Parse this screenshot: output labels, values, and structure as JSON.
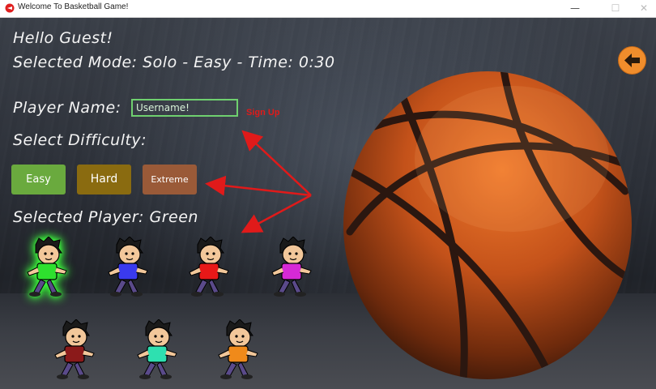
{
  "window": {
    "title": "Welcome To Basketball Game!",
    "minimize": "—",
    "maximize": "☐",
    "close": "✕"
  },
  "header": {
    "greeting": "Hello Guest!",
    "mode_line": "Selected Mode: Solo - Easy - Time: 0:30"
  },
  "form": {
    "player_name_label": "Player Name:",
    "username_value": "Username!",
    "signup_label": "Sign Up",
    "difficulty_label": "Select Difficulty:",
    "difficulty_options": [
      "Easy",
      "Hard",
      "Extreme"
    ],
    "selected_player_label": "Selected Player: Green"
  },
  "players": [
    {
      "shirt": "#2ee02e",
      "selected": true
    },
    {
      "shirt": "#3a3aee"
    },
    {
      "shirt": "#e81818"
    },
    {
      "shirt": "#d629d6"
    },
    {
      "shirt": "#8b1a1a"
    },
    {
      "shirt": "#2ee0b0"
    },
    {
      "shirt": "#f08a1a"
    }
  ],
  "colors": {
    "easy": "#6aaa3e",
    "hard": "#8a6b10",
    "extreme": "#9a5a38",
    "arrow": "#e01a1a",
    "back_button": "#f08d2c"
  },
  "icons": {
    "back": "arrow-left-icon"
  }
}
